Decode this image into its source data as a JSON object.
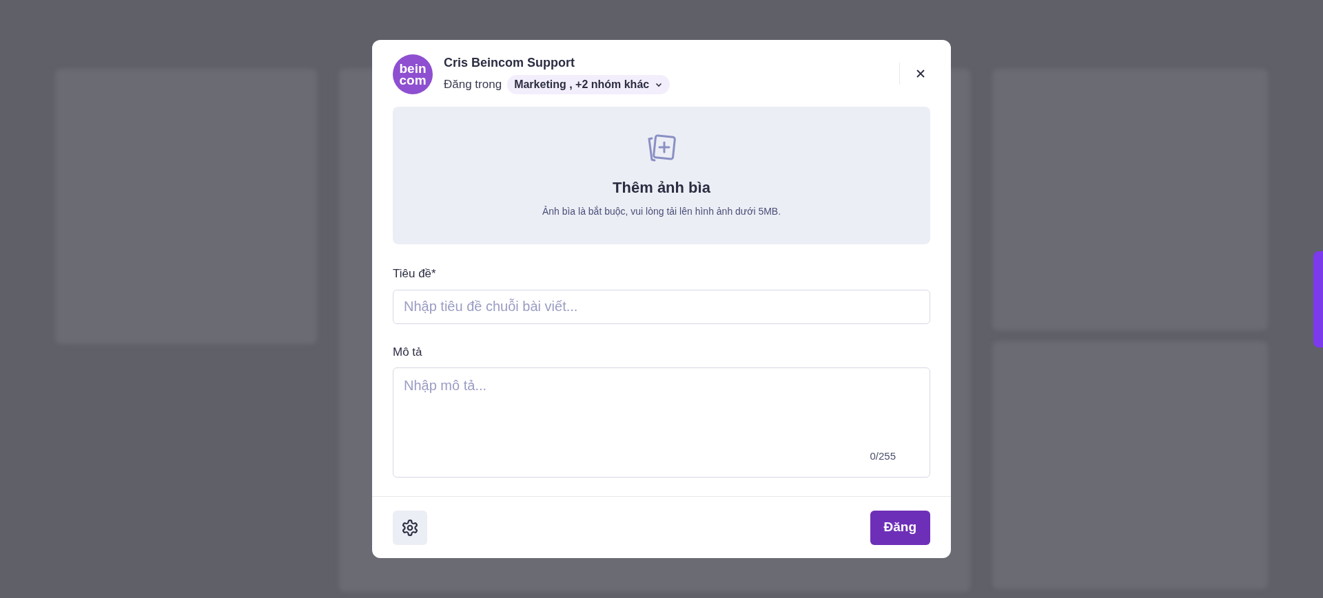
{
  "dialog": {
    "avatar_logo": [
      "bein",
      "com"
    ],
    "author": "Cris Beincom Support",
    "posted_in_label": "Đăng trong",
    "audience_chip": "Marketing , +2 nhóm khác",
    "cover": {
      "title": "Thêm ảnh bìa",
      "hint": "Ảnh bìa là bắt buộc, vui lòng tải lên hình ảnh dưới 5MB."
    },
    "title_field": {
      "label": "Tiêu đề*",
      "placeholder": "Nhập tiêu đề chuỗi bài viết..."
    },
    "description_field": {
      "label": "Mô tả",
      "placeholder": "Nhập mô tả...",
      "counter": "0/255"
    },
    "submit_button": "Đăng"
  }
}
